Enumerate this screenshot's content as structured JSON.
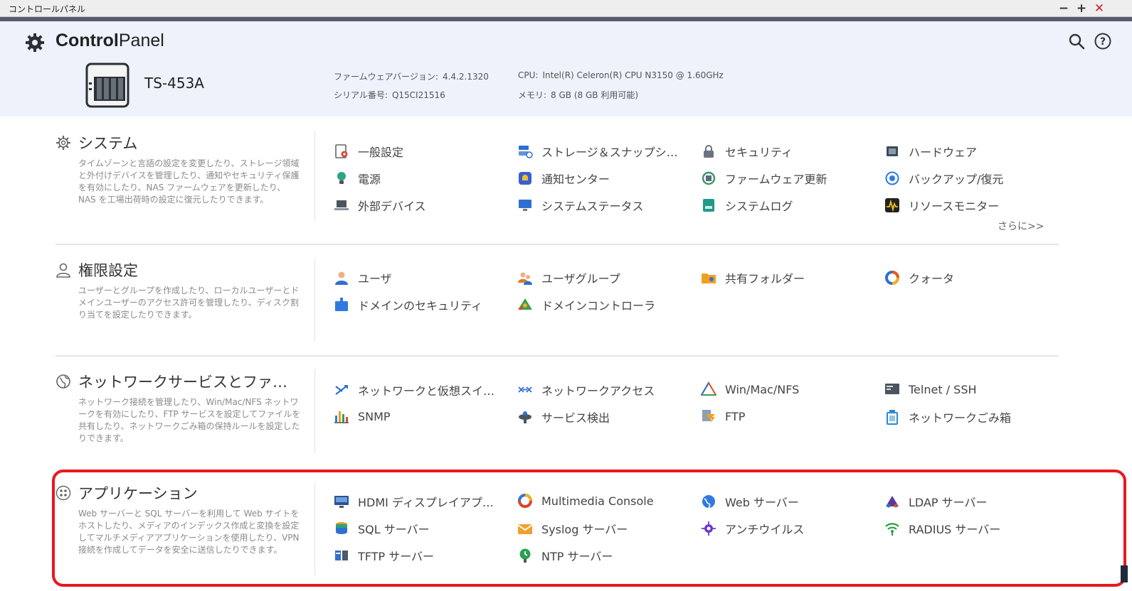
{
  "window": {
    "title": "コントロールパネル",
    "min": "−",
    "max": "+",
    "close": "✕"
  },
  "header": {
    "app_title_bold": "Control",
    "app_title_rest": "Panel",
    "model": "TS-453A",
    "firmware_label": "ファームウェアバージョン:",
    "firmware_value": "4.4.2.1320",
    "serial_label": "シリアル番号:",
    "serial_value": "Q15CI21516",
    "cpu_label": "CPU:",
    "cpu_value": "Intel(R) Celeron(R) CPU N3150 @ 1.60GHz",
    "memory_label": "メモリ:",
    "memory_value": "8 GB (8 GB 利用可能)"
  },
  "sections": [
    {
      "title": "システム",
      "description": "タイムゾーンと言語の設定を変更したり、ストレージ領域と外付けデバイスを管理したり、通知やセキュリティ保護を有効にしたり、NAS ファームウェアを更新したり、NAS を工場出荷時の設定に復元したりできます。",
      "items": [
        {
          "label": "一般設定",
          "icon": "general-settings-icon",
          "color": "#d04a3a"
        },
        {
          "label": "ストレージ＆スナップシ…",
          "icon": "storage-icon",
          "color": "#2f6fd0"
        },
        {
          "label": "セキュリティ",
          "icon": "lock-icon",
          "color": "#6b7280"
        },
        {
          "label": "ハードウェア",
          "icon": "hardware-icon",
          "color": "#3a4a5a"
        },
        {
          "label": "電源",
          "icon": "bulb-icon",
          "color": "#2aa58a"
        },
        {
          "label": "通知センター",
          "icon": "notification-icon",
          "color": "#3a5fcf"
        },
        {
          "label": "ファームウェア更新",
          "icon": "firmware-icon",
          "color": "#3a9a6a"
        },
        {
          "label": "バックアップ/復元",
          "icon": "backup-icon",
          "color": "#2f7ae0"
        },
        {
          "label": "外部デバイス",
          "icon": "laptop-icon",
          "color": "#4a5560"
        },
        {
          "label": "システムステータス",
          "icon": "monitor-icon",
          "color": "#2f6fd0"
        },
        {
          "label": "システムログ",
          "icon": "log-icon",
          "color": "#1f9a8a"
        },
        {
          "label": "リソースモニター",
          "icon": "resource-monitor-icon",
          "color": "#222222"
        }
      ],
      "more": "さらに>>"
    },
    {
      "title": "権限設定",
      "description": "ユーザーとグループを作成したり、ローカルユーザーとドメインユーザーのアクセス許可を管理したり、ディスク割り当てを設定したりできます。",
      "items": [
        {
          "label": "ユーザ",
          "icon": "user-icon",
          "color": "#2f6fd0"
        },
        {
          "label": "ユーザグループ",
          "icon": "user-group-icon",
          "color": "#e07a2a"
        },
        {
          "label": "共有フォルダー",
          "icon": "shared-folder-icon",
          "color": "#f0a020"
        },
        {
          "label": "クォータ",
          "icon": "quota-icon",
          "color": "#e05a2a"
        },
        {
          "label": "ドメインのセキュリティ",
          "icon": "domain-security-icon",
          "color": "#2f7ae0"
        },
        {
          "label": "ドメインコントローラ",
          "icon": "domain-controller-icon",
          "color": "#3aa050"
        }
      ]
    },
    {
      "title": "ネットワークサービスとファ…",
      "description": "ネットワーク接続を管理したり、Win/Mac/NFS ネットワークを有効にしたり、FTP サービスを設定してファイルを共有したり、ネットワークごみ箱の保持ルールを設定したりできます。",
      "items": [
        {
          "label": "ネットワークと仮想スイ…",
          "icon": "network-switch-icon",
          "color": "#2f6fd0"
        },
        {
          "label": "ネットワークアクセス",
          "icon": "network-access-icon",
          "color": "#2f6fd0"
        },
        {
          "label": "Win/Mac/NFS",
          "icon": "winmacnfs-icon",
          "color": "#e04a2a"
        },
        {
          "label": "Telnet / SSH",
          "icon": "terminal-icon",
          "color": "#4a5560"
        },
        {
          "label": "SNMP",
          "icon": "bar-chart-icon",
          "color": "#3a7ad0"
        },
        {
          "label": "サービス検出",
          "icon": "service-discovery-icon",
          "color": "#4a5560"
        },
        {
          "label": "FTP",
          "icon": "ftp-icon",
          "color": "#2f6fd0"
        },
        {
          "label": "ネットワークごみ箱",
          "icon": "recycle-bin-icon",
          "color": "#2a8ad0"
        }
      ]
    },
    {
      "title": "アプリケーション",
      "description": "Web サーバーと SQL サーバーを利用して Web サイトをホストしたり、メディアのインデックス作成と変換を設定してマルチメディアアプリケーションを使用したり、VPN 接続を作成してデータを安全に送信したりできます。",
      "items": [
        {
          "label": "HDMI ディスプレイアプ…",
          "icon": "hdmi-display-icon",
          "color": "#2f4f8f"
        },
        {
          "label": "Multimedia Console",
          "icon": "multimedia-icon",
          "color": "#e0402a"
        },
        {
          "label": "Web サーバー",
          "icon": "globe-icon",
          "color": "#2f7ae0"
        },
        {
          "label": "LDAP サーバー",
          "icon": "ldap-icon",
          "color": "#5a3a9a"
        },
        {
          "label": "SQL サーバー",
          "icon": "database-icon",
          "color": "#e0a020"
        },
        {
          "label": "Syslog サーバー",
          "icon": "mail-icon",
          "color": "#f0a030"
        },
        {
          "label": "アンチウイルス",
          "icon": "antivirus-icon",
          "color": "#6a3ad0"
        },
        {
          "label": "RADIUS サーバー",
          "icon": "wifi-icon",
          "color": "#2aa040"
        },
        {
          "label": "TFTP サーバー",
          "icon": "tftp-icon",
          "color": "#2f6fd0"
        },
        {
          "label": "NTP サーバー",
          "icon": "clock-icon",
          "color": "#2aa050"
        }
      ]
    }
  ]
}
